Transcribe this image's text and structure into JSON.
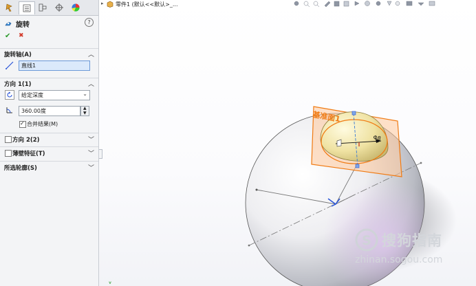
{
  "panel": {
    "tabs": [
      "feature-manager",
      "property-manager",
      "configuration-manager",
      "dimxpert-manager",
      "display-manager"
    ],
    "feature_title": "旋转",
    "help": "?",
    "ok": "✔",
    "cancel": "✖",
    "axis_section": {
      "title": "旋转轴(A)",
      "value": "直线1"
    },
    "direction1": {
      "title": "方向 1(1)",
      "end_condition": "给定深度",
      "angle": "360.00度",
      "merge_label": "合并结果(M)",
      "merge_checked": true
    },
    "direction2": {
      "title": "方向 2(2)",
      "checked": false
    },
    "thin_feature": {
      "title": "薄壁特征(T)",
      "checked": false
    },
    "contours": {
      "title": "所选轮廓(S)"
    }
  },
  "viewport": {
    "tree_label": "零件1 (默认<<默认>_...",
    "plane_label": "基准面1",
    "dimension_label": "Φ8",
    "watermark_brand": "搜狗指南",
    "watermark_url": "zhinan.sogou.com"
  },
  "colors": {
    "accent": "#f07a12",
    "plane_fill": "#ffc89a",
    "dome": "#f2e7a8",
    "ok_green": "#2a9a2a",
    "cancel_red": "#d23a2a",
    "axis_blue": "#2a55d8"
  }
}
